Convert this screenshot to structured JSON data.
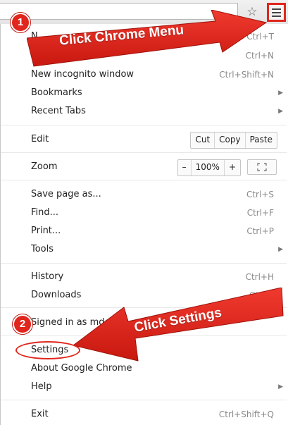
{
  "toolbar": {
    "star_icon": "star-icon",
    "menu_icon": "hamburger-menu-icon"
  },
  "menu": {
    "items": [
      {
        "label": "N",
        "shortcut": "Ctrl+T"
      },
      {
        "label": "N",
        "shortcut": "Ctrl+N"
      },
      {
        "label": "New incognito window",
        "shortcut": "Ctrl+Shift+N"
      },
      {
        "label": "Bookmarks",
        "arrow": "▶"
      },
      {
        "label": "Recent Tabs",
        "arrow": "▶"
      },
      {
        "label": "Edit"
      },
      {
        "label": "Zoom"
      },
      {
        "label": "Save page as...",
        "shortcut": "Ctrl+S"
      },
      {
        "label": "Find...",
        "shortcut": "Ctrl+F"
      },
      {
        "label": "Print...",
        "shortcut": "Ctrl+P"
      },
      {
        "label": "Tools",
        "arrow": "▶"
      },
      {
        "label": "History",
        "shortcut": "Ctrl+H"
      },
      {
        "label": "Downloads",
        "shortcut": "Ctrl+J"
      },
      {
        "label": "Signed in as mde"
      },
      {
        "label": "Settings"
      },
      {
        "label": "About Google Chrome"
      },
      {
        "label": "Help",
        "arrow": "▶"
      },
      {
        "label": "Exit",
        "shortcut": "Ctrl+Shift+Q"
      }
    ],
    "edit": {
      "cut": "Cut",
      "copy": "Copy",
      "paste": "Paste"
    },
    "zoom": {
      "minus": "–",
      "value": "100%",
      "plus": "+",
      "fullscreen_icon": "fullscreen-icon"
    }
  },
  "annotations": {
    "step1": {
      "number": "1",
      "text": "Click Chrome Menu"
    },
    "step2": {
      "number": "2",
      "text": "Click Settings"
    },
    "accent": "#e0261d"
  }
}
